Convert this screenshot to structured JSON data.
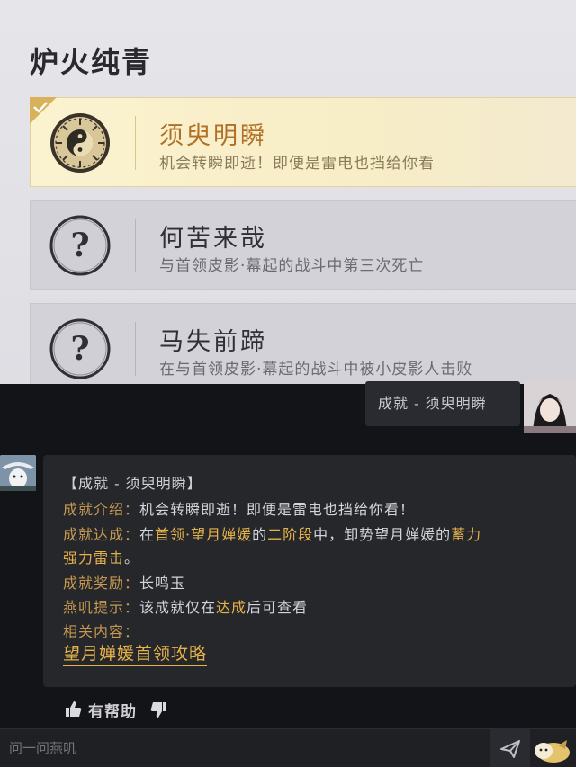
{
  "panel": {
    "title": "炉火纯青",
    "cards": [
      {
        "title": "须臾明瞬",
        "desc": "机会转瞬即逝！即便是雷电也挡给你看",
        "icon": "yin-yang-badge-icon",
        "state": "unlocked"
      },
      {
        "title": "何苦来哉",
        "desc": "与首领皮影·幕起的战斗中第三次死亡",
        "icon": "question-mark-icon",
        "state": "locked"
      },
      {
        "title": "马失前蹄",
        "desc": "在与首领皮影·幕起的战斗中被小皮影人击败",
        "icon": "question-mark-icon",
        "state": "locked"
      }
    ]
  },
  "chat": {
    "user_message": "成就 - 须臾明瞬",
    "bot": {
      "header": "【成就 - 须臾明瞬】",
      "intro_label": "成就介绍：",
      "intro_text": "机会转瞬即逝！即便是雷电也挡给你看！",
      "achieve_label": "成就达成：",
      "achieve_parts": [
        "在",
        "首领·望月婵媛",
        "的",
        "二阶段",
        "中，卸势望月婵媛的",
        "蓄力"
      ],
      "achieve_line2": "强力雷击",
      "achieve_line2_end": "。",
      "reward_label": "成就奖励：",
      "reward_text": "长鸣玉",
      "tip_label": "燕叽提示：",
      "tip_parts": [
        "该成就仅在",
        "达成",
        "后可查看"
      ],
      "related_label": "相关内容：",
      "link": "望月婵媛首领攻略"
    },
    "feedback_label": "有帮助",
    "input_placeholder": "问一问燕叽"
  },
  "colors": {
    "accent": "#e5b24a",
    "label": "#c79a52",
    "active_title": "#b27027"
  }
}
